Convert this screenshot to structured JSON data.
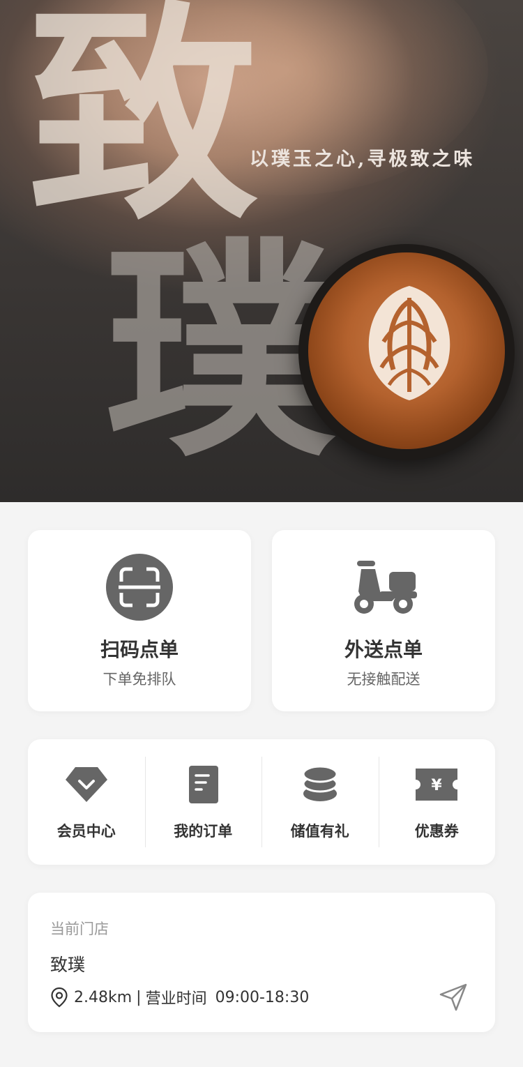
{
  "hero": {
    "char_top": "致",
    "char_bottom": "璞",
    "slogan": "以璞玉之心,寻极致之味"
  },
  "order_cards": [
    {
      "title": "扫码点单",
      "subtitle": "下单免排队",
      "icon": "scan-qr-icon"
    },
    {
      "title": "外送点单",
      "subtitle": "无接触配送",
      "icon": "delivery-scooter-icon"
    }
  ],
  "menu": [
    {
      "label": "会员中心",
      "icon": "member-diamond-icon"
    },
    {
      "label": "我的订单",
      "icon": "order-document-icon"
    },
    {
      "label": "储值有礼",
      "icon": "coin-stack-icon"
    },
    {
      "label": "优惠券",
      "icon": "coupon-icon"
    }
  ],
  "store": {
    "caption": "当前门店",
    "name": "致璞",
    "distance": "2.48km",
    "separator": "|",
    "hours_label": "营业时间",
    "hours": "09:00-18:30"
  },
  "colors": {
    "icon_gray": "#666666",
    "background": "#f4f4f4",
    "card": "#ffffff"
  }
}
